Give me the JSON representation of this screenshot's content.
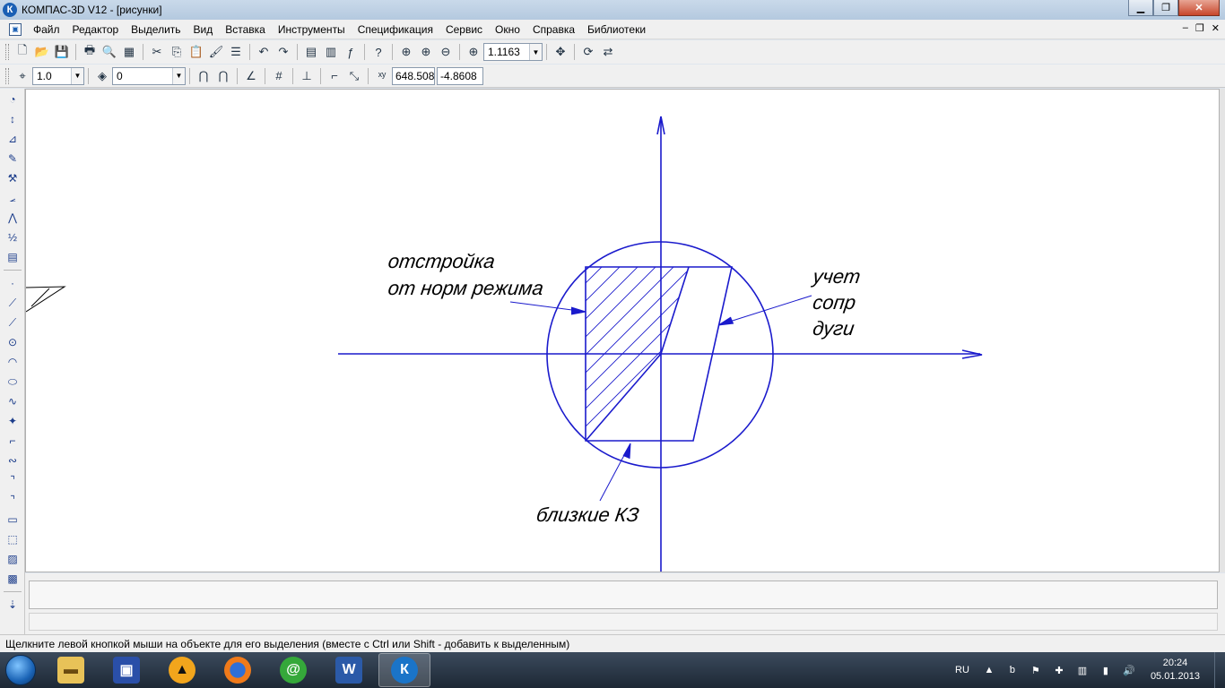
{
  "window": {
    "title": "КОМПАС-3D V12 - [рисунки]",
    "app_icon_letter": "К"
  },
  "menu": {
    "items": [
      {
        "label": "Файл"
      },
      {
        "label": "Редактор"
      },
      {
        "label": "Выделить"
      },
      {
        "label": "Вид"
      },
      {
        "label": "Вставка"
      },
      {
        "label": "Инструменты"
      },
      {
        "label": "Спецификация"
      },
      {
        "label": "Сервис"
      },
      {
        "label": "Окно"
      },
      {
        "label": "Справка"
      },
      {
        "label": "Библиотеки"
      }
    ]
  },
  "toolbar": {
    "zoom_value": "1.1163",
    "step_value": "1.0",
    "layer_value": "0",
    "coord_x": "648.508",
    "coord_y": "-4.8608"
  },
  "drawing": {
    "label_otstroika_line1": "отстройка",
    "label_otstroika_line2": "от норм режима",
    "label_uchet_line1": "учет",
    "label_uchet_line2": "сопр",
    "label_uchet_line3": "дуги",
    "label_blizkie": "близкие КЗ",
    "stroke_color": "#1a1acc"
  },
  "statusbar": {
    "message": "Щелкните левой кнопкой мыши на объекте для его выделения (вместе с Ctrl или Shift - добавить к выделенным)"
  },
  "taskbar": {
    "lang": "RU",
    "time": "20:24",
    "date": "05.01.2013"
  }
}
